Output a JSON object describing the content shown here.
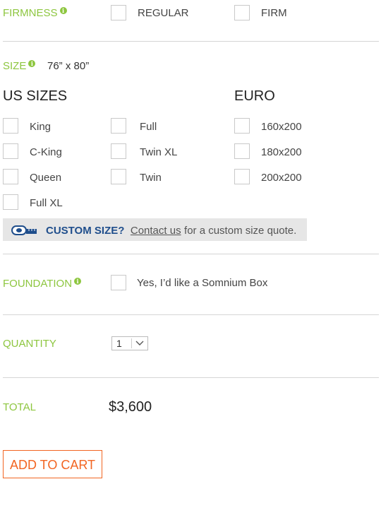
{
  "firmness": {
    "label": "FIRMNESS",
    "info_icon": "i",
    "options": [
      "REGULAR",
      "FIRM"
    ]
  },
  "size": {
    "label": "SIZE",
    "info_icon": "i",
    "dimensions": "76” x 80”",
    "us_heading": "US SIZES",
    "euro_heading": "EURO",
    "us_col1": [
      "King",
      "C-King",
      "Queen",
      "Full XL"
    ],
    "us_col2": [
      "Full",
      "Twin XL",
      "Twin"
    ],
    "euro_options": [
      "160x200",
      "180x200",
      "200x200"
    ]
  },
  "custom_size": {
    "icon": "tape-measure-icon",
    "lead": "CUSTOM SIZE?",
    "link": "Contact us",
    "rest": "for a custom size quote."
  },
  "foundation": {
    "label": "FOUNDATION",
    "info_icon": "i",
    "option": "Yes, I’d like a Somnium Box"
  },
  "quantity": {
    "label": "QUANTITY",
    "value": "1"
  },
  "total": {
    "label": "TOTAL",
    "price": "$3,600"
  },
  "cart": {
    "button_label": "ADD TO CART"
  },
  "colors": {
    "label_green": "#8dc63f",
    "cart_orange": "#f26522",
    "custom_blue": "#1f4e8c"
  }
}
